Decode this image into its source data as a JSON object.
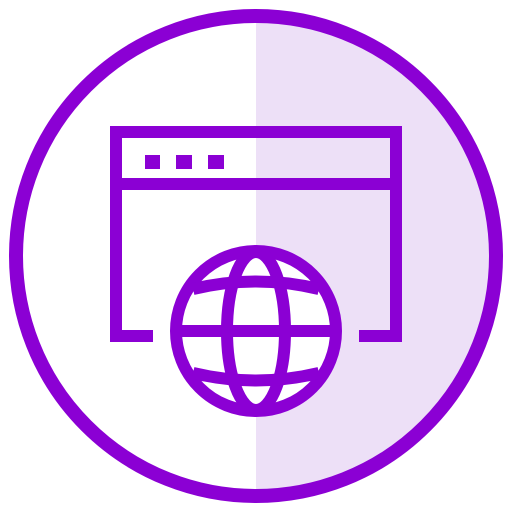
{
  "icon": {
    "name": "web-browser-globe-icon",
    "colors": {
      "stroke": "#8b00d4",
      "half_fill": "#ede0f7",
      "background": "#ffffff"
    }
  }
}
